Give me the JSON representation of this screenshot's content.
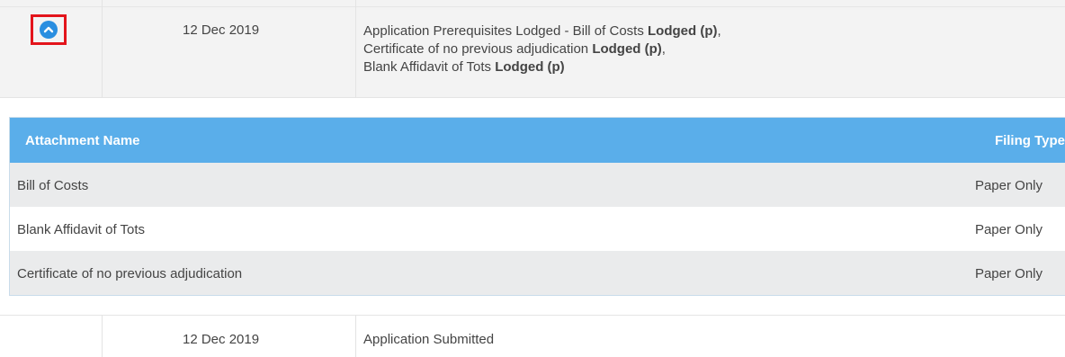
{
  "history_row": {
    "date": "12 Dec 2019",
    "line1_text": "Application Prerequisites Lodged - Bill of Costs ",
    "line1_status": "Lodged (p)",
    "line2_text": "Certificate of no previous adjudication ",
    "line2_status": "Lodged (p)",
    "line3_text": "Blank Affidavit of Tots ",
    "line3_status": "Lodged (p)",
    "toggle_icon": "chevron-up-icon",
    "toggle_color": "#2a8ee0",
    "highlight_color": "#e3141b"
  },
  "attachments": {
    "header_color": "#5aaeea",
    "columns": [
      "Attachment Name",
      "Filing Type"
    ],
    "rows": [
      {
        "name": "Bill of Costs",
        "type": "Paper Only"
      },
      {
        "name": "Blank Affidavit of Tots",
        "type": "Paper Only"
      },
      {
        "name": "Certificate of no previous adjudication",
        "type": "Paper Only"
      }
    ]
  },
  "second_row": {
    "date": "12 Dec 2019",
    "description": "Application Submitted"
  }
}
